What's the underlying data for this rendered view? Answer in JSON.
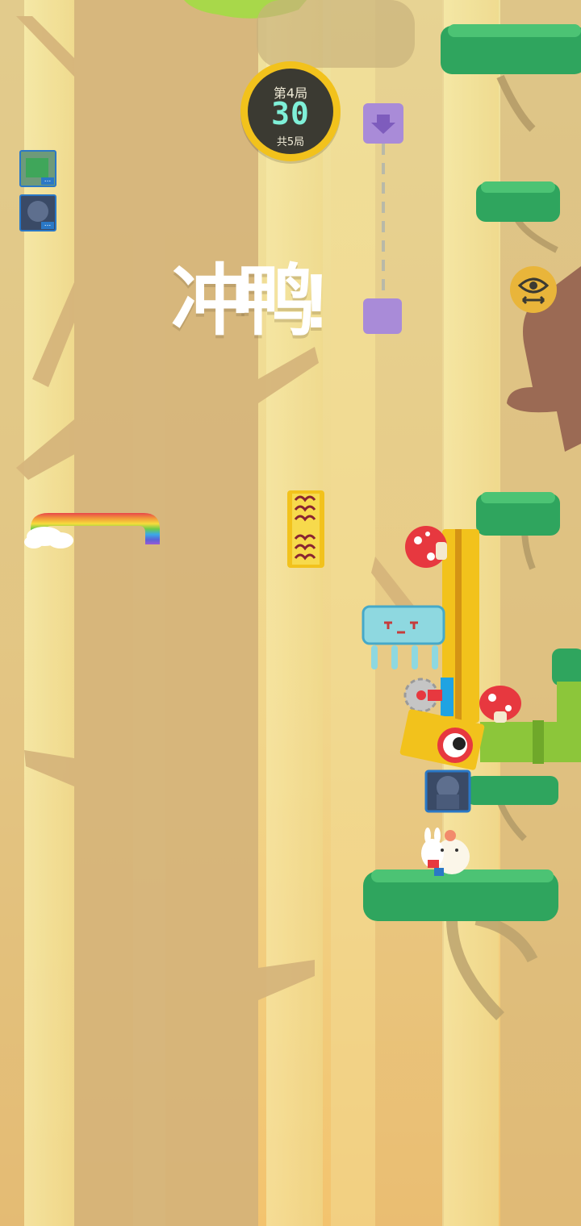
{
  "hud": {
    "round_label": "第4局",
    "timer": "30",
    "total_rounds": "共5局"
  },
  "banner": {
    "text": "冲鸭!"
  },
  "colors": {
    "sky_light": "#f7e39a",
    "sky_bottom": "#f3c36e",
    "trunk": "#d3b27a",
    "leaf": "#2fa55e",
    "badge_ring": "#f2c21c",
    "badge_fill": "#3b3a32",
    "timer_color": "#7ff0d8"
  },
  "icons": {
    "view_toggle": "eye-arrows-icon",
    "drop_marker": "down-arrow-icon"
  }
}
